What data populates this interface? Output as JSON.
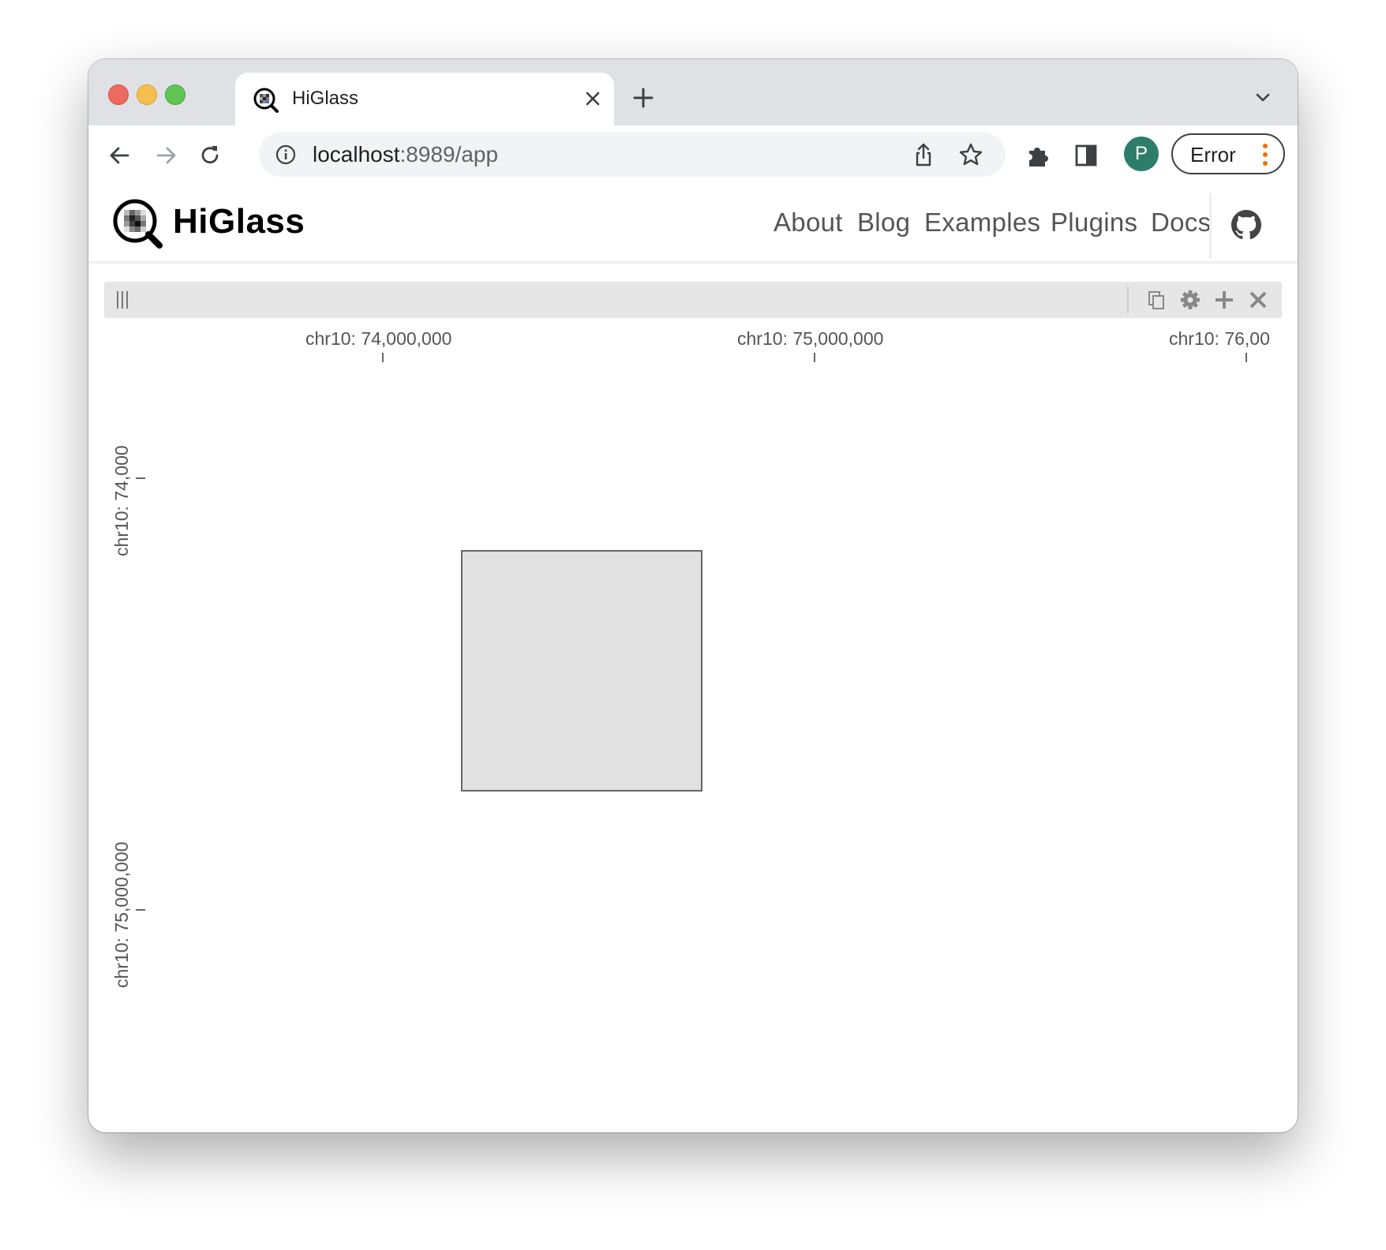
{
  "browser": {
    "tab_title": "HiGlass",
    "url_host": "localhost",
    "url_rest": ":8989/app",
    "profile_initial": "P",
    "error_label": "Error"
  },
  "higlass": {
    "title": "HiGlass",
    "nav": [
      "About",
      "Blog",
      "Examples",
      "Plugins",
      "Docs"
    ]
  },
  "view": {
    "x_ticks": [
      "chr10: 74,000,000",
      "chr10: 75,000,000",
      "chr10: 76,00"
    ],
    "y_ticks": [
      "chr10: 74,000",
      "chr10: 75,000,000"
    ]
  },
  "colors": {
    "close": "#ed6a5e",
    "minimize": "#f5bf4f",
    "maximize": "#61c554",
    "avatar": "#2e7d6b",
    "accent_dots": "#e8710a",
    "region_fill": "#e1e1e1"
  },
  "icons": {
    "toolbar": [
      "back-arrow-icon",
      "forward-arrow-icon",
      "reload-icon",
      "info-icon",
      "share-icon",
      "star-icon",
      "extensions-icon",
      "side-panel-icon",
      "kebab-menu-icon"
    ],
    "view": [
      "drag-grip-icon",
      "copy-icon",
      "settings-icon",
      "add-icon",
      "close-icon"
    ]
  }
}
